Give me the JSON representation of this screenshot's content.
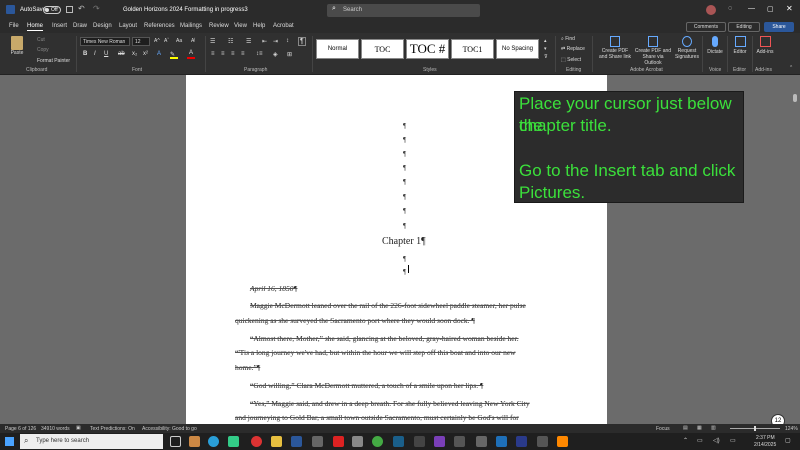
{
  "titlebar": {
    "autosave_label": "AutoSave",
    "autosave_state": "Off",
    "doc_title": "Golden Horizons 2024 Formatting in progress3",
    "search_placeholder": "Search"
  },
  "menubar": {
    "tabs": [
      "File",
      "Home",
      "Insert",
      "Draw",
      "Design",
      "Layout",
      "References",
      "Mailings",
      "Review",
      "View",
      "Help",
      "Acrobat"
    ],
    "active_tab": "Home",
    "comments_label": "Comments",
    "editing_label": "Editing",
    "share_label": "Share"
  },
  "ribbon": {
    "clipboard": {
      "paste": "Paste",
      "cut": "Cut",
      "copy": "Copy",
      "format_painter": "Format Painter",
      "label": "Clipboard"
    },
    "font": {
      "name": "Times New Roman",
      "size": "12",
      "label": "Font"
    },
    "paragraph": {
      "label": "Paragraph"
    },
    "styles": {
      "items": [
        "Normal",
        "TOC",
        "TOC #",
        "TOC1",
        "No Spacing"
      ],
      "label": "Styles"
    },
    "editing": {
      "find": "Find",
      "replace": "Replace",
      "select": "Select",
      "label": "Editing"
    },
    "acrobat": {
      "create_pdf": "Create PDF and Share link",
      "create_pdf_outlook": "Create PDF and Share via Outlook",
      "request_signatures": "Request Signatures",
      "label": "Adobe Acrobat"
    },
    "voice": {
      "dictate": "Dictate",
      "label": "Voice"
    },
    "editor": {
      "editor": "Editor",
      "label": "Editor"
    },
    "addins": {
      "addins": "Add-ins",
      "label": "Add-ins"
    }
  },
  "document": {
    "chapter_title": "Chapter 1¶",
    "date_line": "April 16, 1850¶",
    "paragraphs": [
      "Maggie McDermott leaned over the rail of the 226-foot sidewheel paddle steamer, her pulse",
      "quickening as she surveyed the Sacramento port where they would soon dock. ¶",
      "“Almost there, Mother,” she said, glancing at the beloved, gray-haired woman beside her.",
      "“'Tis a long journey we've had, but within the hour we will step off this boat and into our new",
      "home.”¶",
      "“God willing,” Clara McDermott muttered, a touch of a smile upon her lips. ¶",
      "“Yes,” Maggie said, and drew in a deep breath. For she fully believed leaving New York City",
      "and journeying to Gold Bar, a small town outside Sacramento, must certainly be God's will for"
    ]
  },
  "overlay": {
    "line1": "Place your cursor just below the",
    "line2": "chapter title.",
    "line3": "Go to the Insert tab and click",
    "line4": "Pictures."
  },
  "statusbar": {
    "page": "Page 6 of 126",
    "words": "34910 words",
    "text_predictions": "Text Predictions: On",
    "accessibility": "Accessibility: Good to go",
    "focus": "Focus",
    "zoom": "124%"
  },
  "taskbar": {
    "search_placeholder": "Type here to search",
    "time": "2:37 PM",
    "date": "2/14/2025",
    "notification_count": "12"
  },
  "colors": {
    "overlay_text": "#3be03b",
    "accent": "#2b579a"
  }
}
